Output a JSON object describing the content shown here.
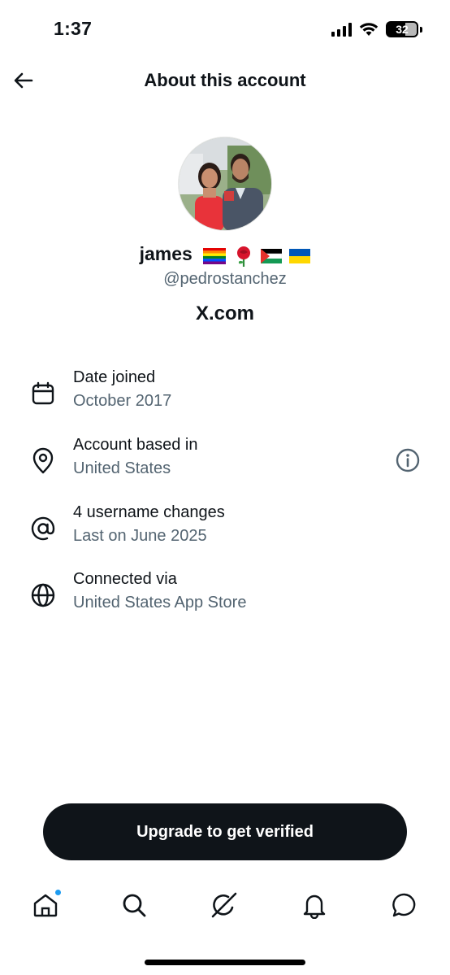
{
  "status_bar": {
    "time": "1:37",
    "battery": "32"
  },
  "header": {
    "title": "About this account"
  },
  "profile": {
    "display_name": "james",
    "flags": [
      "rainbow-flag",
      "rose",
      "palestine-flag",
      "ukraine-flag"
    ],
    "handle": "@pedrostanchez",
    "site": "X.com"
  },
  "info": [
    {
      "icon": "calendar-icon",
      "title": "Date joined",
      "subtitle": "October 2017"
    },
    {
      "icon": "location-pin-icon",
      "title": "Account based in",
      "subtitle": "United States"
    },
    {
      "icon": "at-sign-icon",
      "title": "4 username changes",
      "subtitle": "Last on June 2025"
    },
    {
      "icon": "globe-icon",
      "title": "Connected via",
      "subtitle": "United States App Store"
    }
  ],
  "upgrade_label": "Upgrade to get verified",
  "nav": [
    "home-icon",
    "search-icon",
    "grok-icon",
    "notifications-icon",
    "messages-icon"
  ],
  "colors": {
    "primary_text": "#0f1419",
    "secondary_text": "#536471",
    "accent": "#1d9bf0"
  }
}
